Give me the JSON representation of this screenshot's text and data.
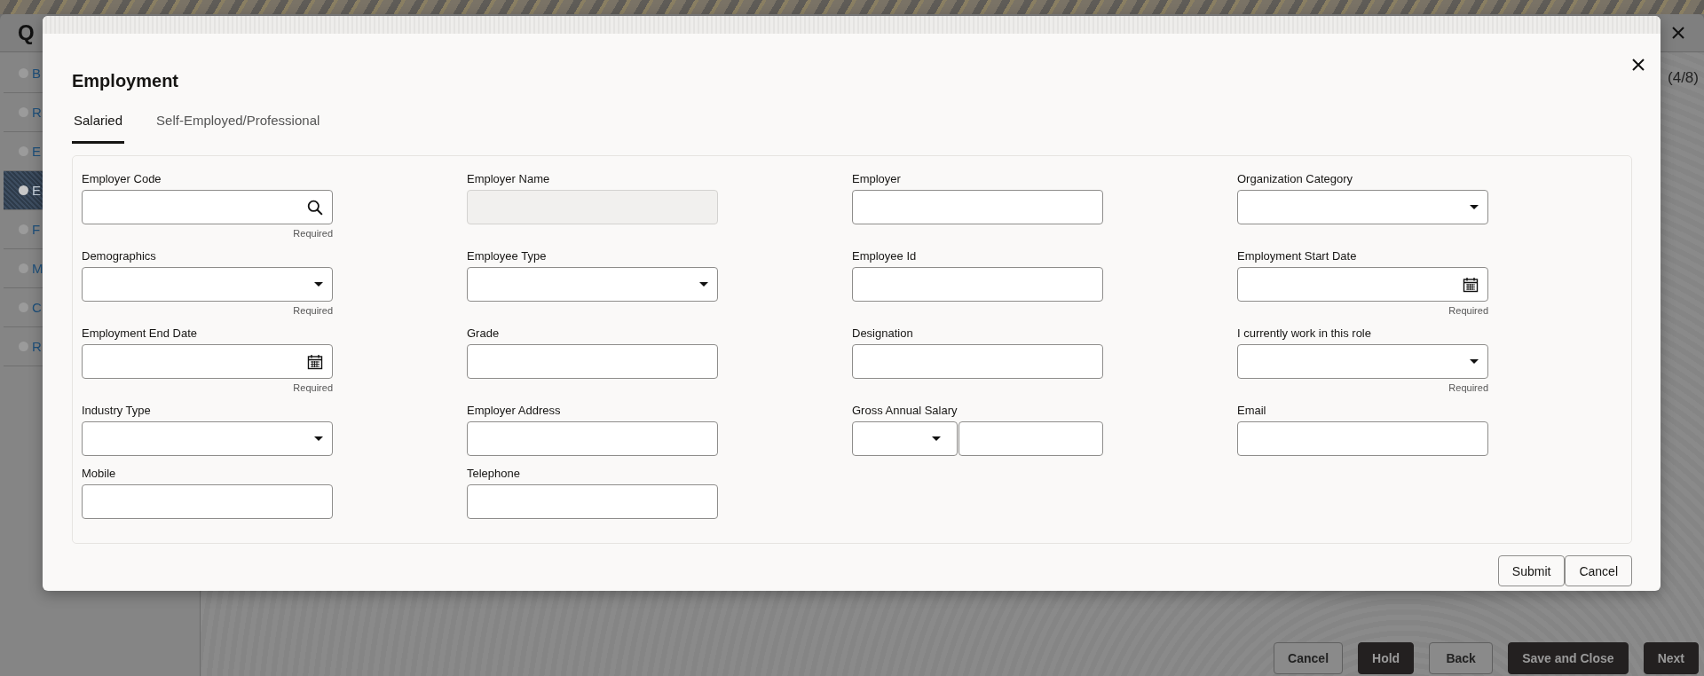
{
  "page": {
    "title": "Q",
    "progress": "(4/8)"
  },
  "sidebar": {
    "items": [
      {
        "label": "B",
        "selected": false
      },
      {
        "label": "R",
        "selected": false
      },
      {
        "label": "E",
        "selected": false
      },
      {
        "label": "E",
        "selected": true
      },
      {
        "label": "F",
        "selected": false
      },
      {
        "label": "M",
        "selected": false
      },
      {
        "label": "C",
        "selected": false
      },
      {
        "label": "R",
        "selected": false
      }
    ]
  },
  "footer_buttons": [
    {
      "label": "Cancel",
      "kind": "outline"
    },
    {
      "label": "Hold",
      "kind": "solid"
    },
    {
      "label": "Back",
      "kind": "outline"
    },
    {
      "label": "Save and Close",
      "kind": "solid"
    },
    {
      "label": "Next",
      "kind": "solid"
    }
  ],
  "dialog": {
    "title": "Employment",
    "tabs": [
      {
        "label": "Salaried",
        "selected": true
      },
      {
        "label": "Self-Employed/Professional",
        "selected": false
      }
    ],
    "fields": [
      {
        "label": "Employer Code",
        "kind": "search",
        "hint": "Required"
      },
      {
        "label": "Employer Name",
        "kind": "disabled"
      },
      {
        "label": "Employer",
        "kind": "text"
      },
      {
        "label": "Organization Category",
        "kind": "select"
      },
      {
        "label": "Demographics",
        "kind": "select",
        "hint": "Required"
      },
      {
        "label": "Employee Type",
        "kind": "select"
      },
      {
        "label": "Employee Id",
        "kind": "text"
      },
      {
        "label": "Employment Start Date",
        "kind": "date",
        "hint": "Required"
      },
      {
        "label": "Employment End Date",
        "kind": "date",
        "hint": "Required"
      },
      {
        "label": "Grade",
        "kind": "text"
      },
      {
        "label": "Designation",
        "kind": "text"
      },
      {
        "label": "I currently work in this role",
        "kind": "select",
        "hint": "Required"
      },
      {
        "label": "Industry Type",
        "kind": "select"
      },
      {
        "label": "Employer Address",
        "kind": "text"
      },
      {
        "label": "Gross Annual Salary",
        "kind": "currency"
      },
      {
        "label": "Email",
        "kind": "text"
      },
      {
        "label": "Mobile",
        "kind": "text"
      },
      {
        "label": "Telephone",
        "kind": "text"
      }
    ],
    "buttons": [
      "Submit",
      "Cancel"
    ]
  }
}
